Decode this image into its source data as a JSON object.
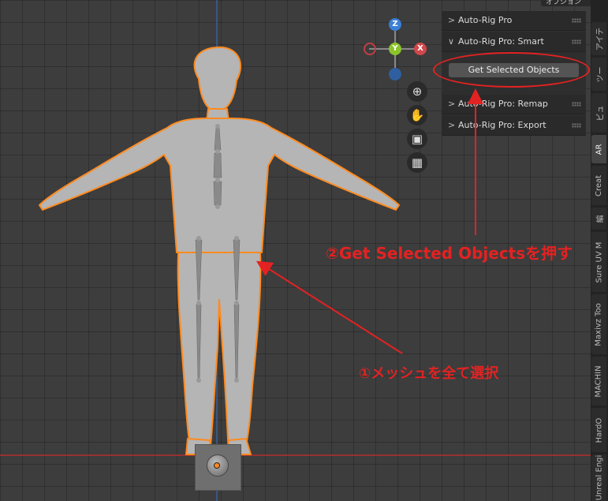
{
  "viewport": {
    "gizmo": {
      "z": "Z",
      "y": "Y",
      "x": "X"
    }
  },
  "header": {
    "options_label": "オプション"
  },
  "npanel": {
    "sections": [
      {
        "label": "Auto-Rig Pro",
        "expanded": false
      },
      {
        "label": "Auto-Rig Pro: Smart",
        "expanded": true
      },
      {
        "label": "Auto-Rig Pro: Remap",
        "expanded": false
      },
      {
        "label": "Auto-Rig Pro: Export",
        "expanded": false
      }
    ],
    "get_selected_button": "Get Selected Objects"
  },
  "sidebar_tabs": [
    "アイテ",
    "ツー",
    "ビュ",
    "AR",
    "Creat",
    "編",
    "Sure UV M",
    "Maxivz Too",
    "MACHIN",
    "HardO",
    "Unreal Engi"
  ],
  "annotations": {
    "step1": "①メッシュを全て選択",
    "step2": "②Get Selected Objectsを押す"
  },
  "colors": {
    "annotation": "#e32222",
    "selection_outline": "#ff8a1f",
    "x_axis": "#d0484b",
    "y_axis": "#8bc42a",
    "z_axis": "#3b7fd6"
  }
}
